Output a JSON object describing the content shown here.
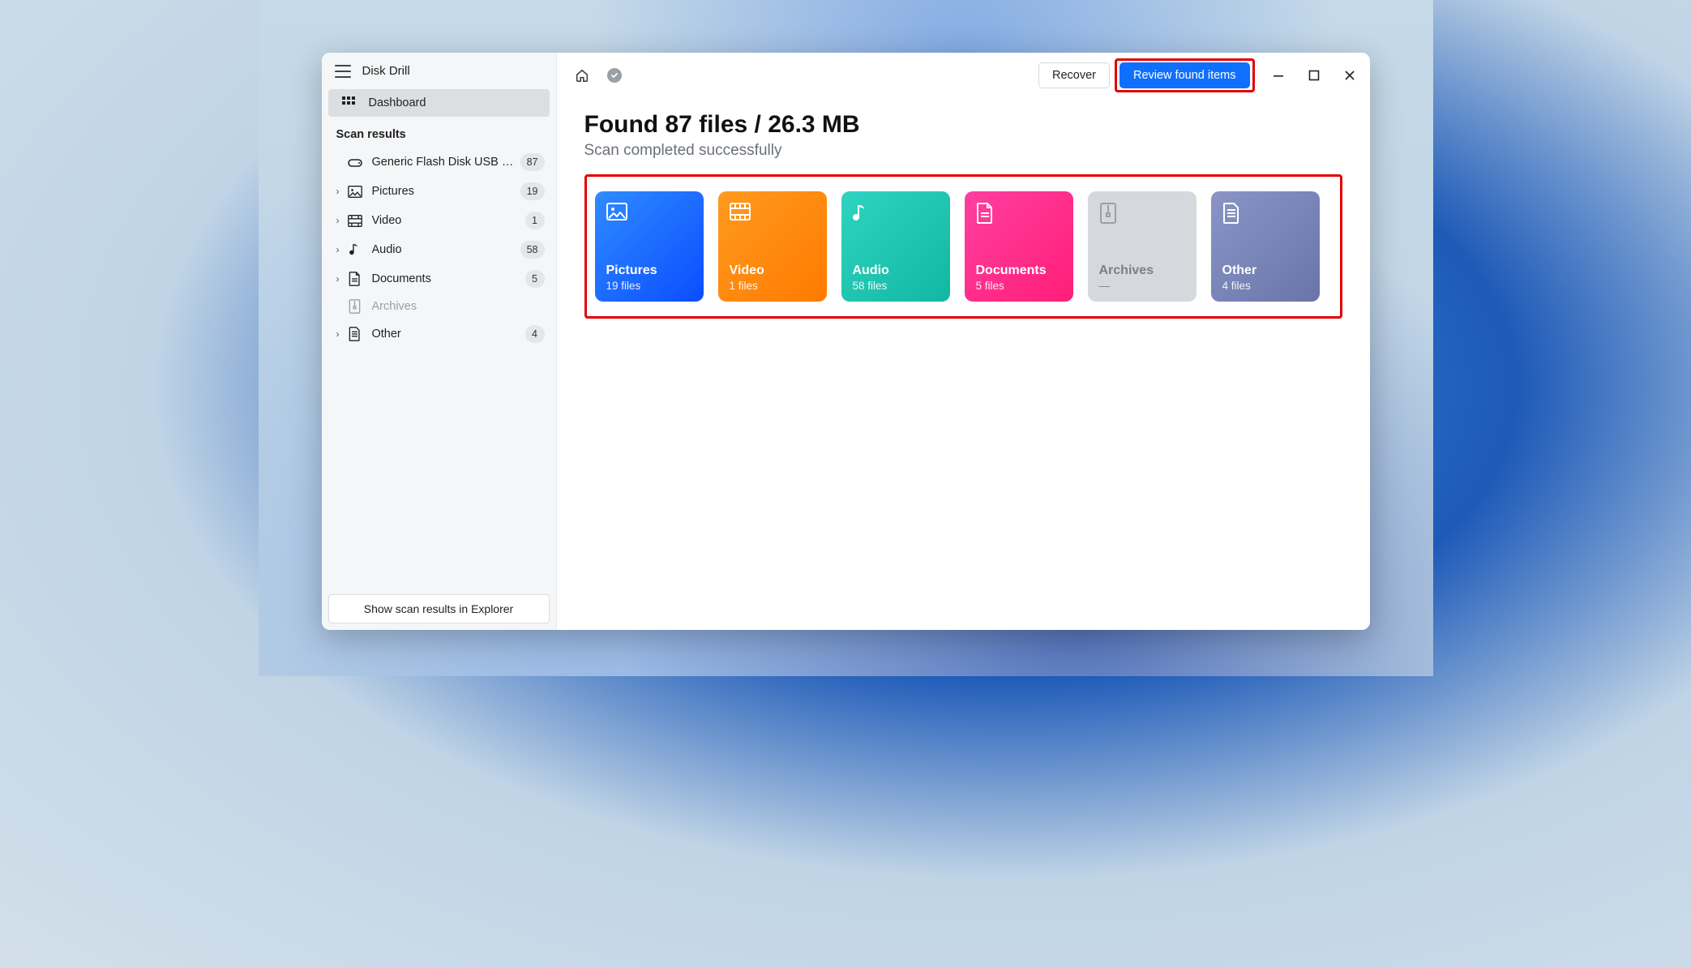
{
  "app": {
    "title": "Disk Drill"
  },
  "sidebar": {
    "dashboard_label": "Dashboard",
    "section_label": "Scan results",
    "device": {
      "label": "Generic Flash Disk USB D…",
      "count": "87"
    },
    "items": [
      {
        "key": "pictures",
        "label": "Pictures",
        "count": "19",
        "icon": "image-icon",
        "expandable": true
      },
      {
        "key": "video",
        "label": "Video",
        "count": "1",
        "icon": "film-icon",
        "expandable": true
      },
      {
        "key": "audio",
        "label": "Audio",
        "count": "58",
        "icon": "music-icon",
        "expandable": true
      },
      {
        "key": "documents",
        "label": "Documents",
        "count": "5",
        "icon": "document-icon",
        "expandable": true
      },
      {
        "key": "archives",
        "label": "Archives",
        "count": "",
        "icon": "archive-icon",
        "expandable": false,
        "disabled": true
      },
      {
        "key": "other",
        "label": "Other",
        "count": "4",
        "icon": "other-icon",
        "expandable": true
      }
    ],
    "footer_button": "Show scan results in Explorer"
  },
  "toolbar": {
    "recover_label": "Recover",
    "review_label": "Review found items"
  },
  "main": {
    "headline": "Found 87 files / 26.3 MB",
    "subhead": "Scan completed successfully",
    "cards": [
      {
        "key": "pictures",
        "title": "Pictures",
        "sub": "19 files",
        "class": "pictures",
        "icon": "image-icon"
      },
      {
        "key": "video",
        "title": "Video",
        "sub": "1 files",
        "class": "video",
        "icon": "film-icon"
      },
      {
        "key": "audio",
        "title": "Audio",
        "sub": "58 files",
        "class": "audio",
        "icon": "music-icon"
      },
      {
        "key": "documents",
        "title": "Documents",
        "sub": "5 files",
        "class": "documents",
        "icon": "document-icon"
      },
      {
        "key": "archives",
        "title": "Archives",
        "sub": "—",
        "class": "archives",
        "icon": "archive-icon"
      },
      {
        "key": "other",
        "title": "Other",
        "sub": "4 files",
        "class": "other",
        "icon": "other-icon"
      }
    ]
  }
}
